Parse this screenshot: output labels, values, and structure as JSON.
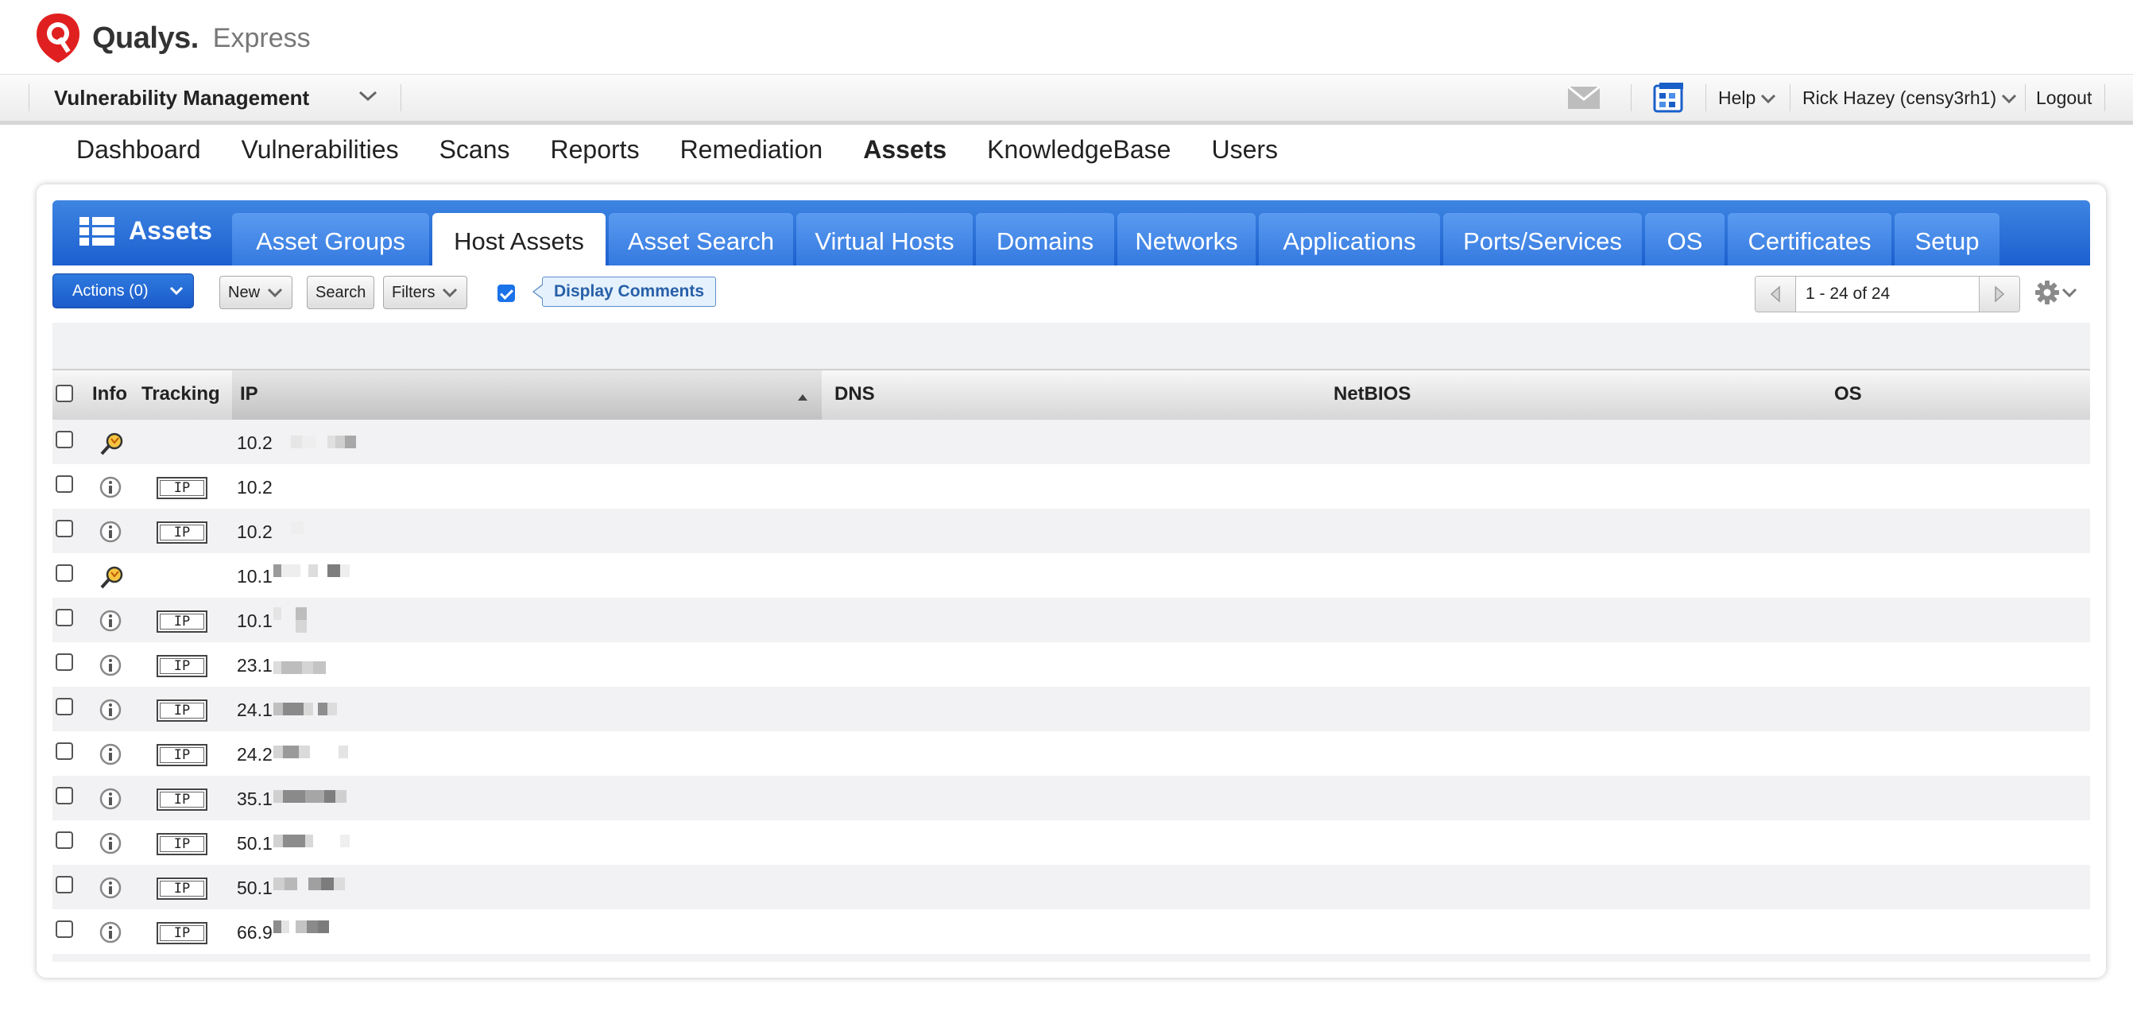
{
  "brand": {
    "name": "Qualys.",
    "edition": "Express",
    "logo_icon": "qualys-shield-logo",
    "accent": "#e02020"
  },
  "appbar": {
    "module": "Vulnerability Management",
    "help_label": "Help",
    "user_label": "Rick Hazey (censy3rh1)",
    "logout_label": "Logout",
    "icons": [
      "mail-icon",
      "calculator-icon"
    ]
  },
  "mainnav": {
    "items": [
      "Dashboard",
      "Vulnerabilities",
      "Scans",
      "Reports",
      "Remediation",
      "Assets",
      "KnowledgeBase",
      "Users"
    ],
    "active": "Assets"
  },
  "assets_header": {
    "title": "Assets",
    "icon": "list-icon"
  },
  "tabs": {
    "items": [
      "Asset Groups",
      "Host Assets",
      "Asset Search",
      "Virtual Hosts",
      "Domains",
      "Networks",
      "Applications",
      "Ports/Services",
      "OS",
      "Certificates",
      "Setup"
    ],
    "active": "Host Assets"
  },
  "toolbar": {
    "actions_label": "Actions (0)",
    "new_label": "New",
    "search_label": "Search",
    "filters_label": "Filters",
    "display_comments_label": "Display Comments",
    "display_comments_checked": true,
    "pagination": "1 - 24 of 24"
  },
  "table": {
    "columns": [
      "Info",
      "Tracking",
      "IP",
      "DNS",
      "NetBIOS",
      "OS"
    ],
    "sorted_column": "IP",
    "rows": [
      {
        "info": "tag-search-icon",
        "tracking": "",
        "ip": "10.2"
      },
      {
        "info": "info-icon",
        "tracking": "IP",
        "ip": "10.2"
      },
      {
        "info": "info-icon",
        "tracking": "IP",
        "ip": "10.2"
      },
      {
        "info": "tag-search-icon",
        "tracking": "",
        "ip": "10.1"
      },
      {
        "info": "info-icon",
        "tracking": "IP",
        "ip": "10.1"
      },
      {
        "info": "info-icon",
        "tracking": "IP",
        "ip": "23.1"
      },
      {
        "info": "info-icon",
        "tracking": "IP",
        "ip": "24.1"
      },
      {
        "info": "info-icon",
        "tracking": "IP",
        "ip": "24.2"
      },
      {
        "info": "info-icon",
        "tracking": "IP",
        "ip": "35.1"
      },
      {
        "info": "info-icon",
        "tracking": "IP",
        "ip": "50.1"
      },
      {
        "info": "info-icon",
        "tracking": "IP",
        "ip": "50.1"
      },
      {
        "info": "info-icon",
        "tracking": "IP",
        "ip": "66.9"
      }
    ]
  },
  "colors": {
    "primary_blue": "#1c5fcf",
    "tab_blue": "#3479e0",
    "row_alt": "#f2f2f4"
  }
}
